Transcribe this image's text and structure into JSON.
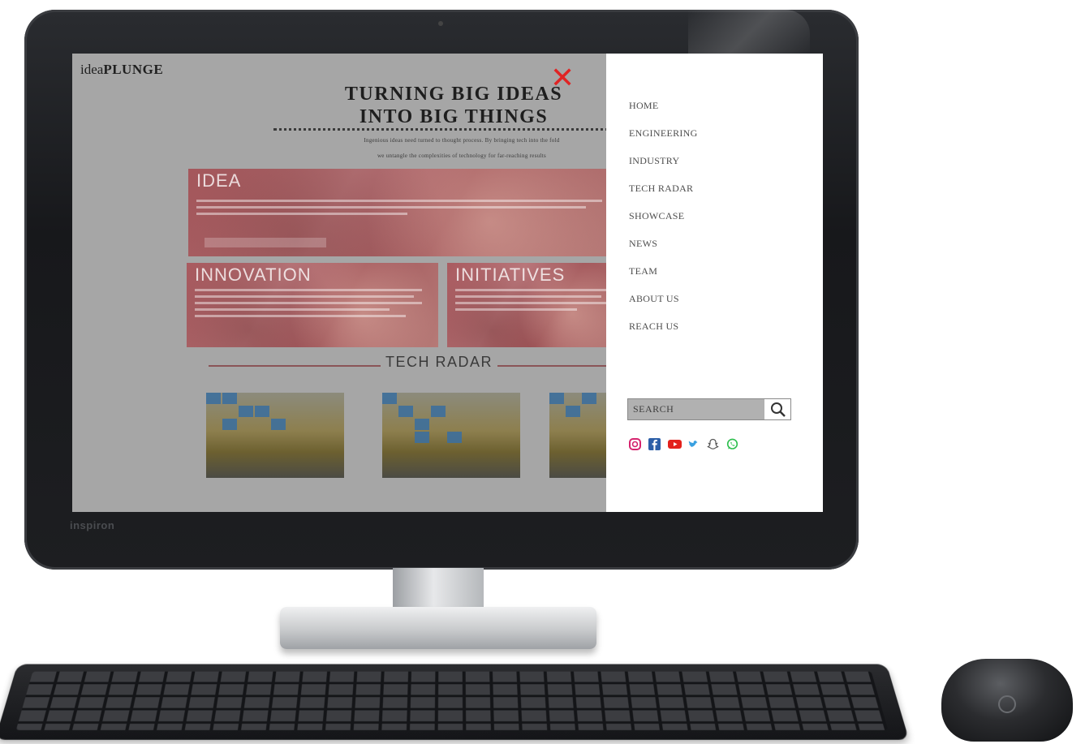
{
  "site": {
    "logo_prefix": "idea",
    "logo_bold": "PLUNGE"
  },
  "hero": {
    "title_line1": "TURNING BIG IDEAS",
    "title_line2": "INTO BIG THINGS",
    "tagline_line1": "Ingenious ideas need turned to thought process. By bringing tech into the fold",
    "tagline_line2": "we untangle the complexities of technology for far-reaching results"
  },
  "cards": [
    {
      "title": "IDEA"
    },
    {
      "title": "INNOVATION"
    },
    {
      "title": "INITIATIVES"
    }
  ],
  "tech_radar": {
    "title": "TECH RADAR"
  },
  "menu": {
    "close_icon": "close-icon",
    "items": [
      "HOME",
      "ENGINEERING",
      "INDUSTRY",
      "TECH RADAR",
      "SHOWCASE",
      "NEWS",
      "TEAM",
      "ABOUT US",
      "REACH US"
    ]
  },
  "search": {
    "placeholder": "SEARCH",
    "icon": "search-icon"
  },
  "social": {
    "icons": [
      "instagram-icon",
      "facebook-icon",
      "youtube-icon",
      "twitter-icon",
      "snapchat-icon",
      "whatsapp-icon"
    ]
  },
  "colors": {
    "overlay": "#a6a6a6",
    "close": "#e02424",
    "card_red": "#a95a5f"
  }
}
